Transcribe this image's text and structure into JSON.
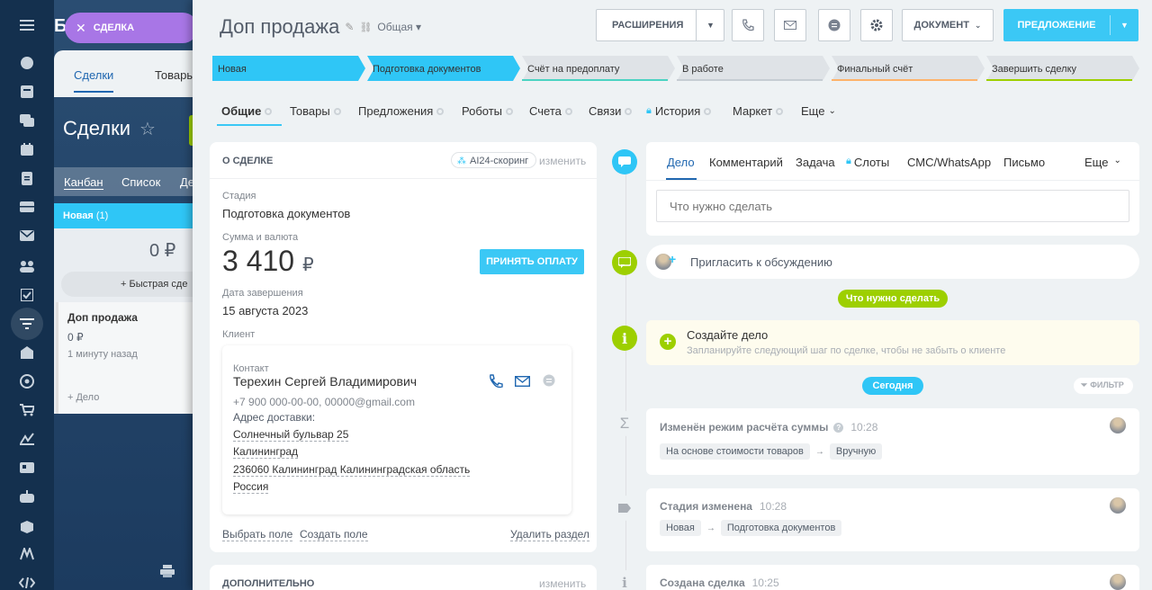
{
  "bg": {
    "logo": "Битрикс",
    "deal_pill": "СДЕЛКА",
    "tabs": [
      "Сделки",
      "Товары"
    ],
    "page_title": "Сделки",
    "views": [
      "Канбан",
      "Список",
      "Де"
    ],
    "column": {
      "name": "Новая",
      "count": "(1)",
      "sum": "0 ₽",
      "quick_add": "Быстрая сде"
    },
    "card": {
      "title": "Доп продажа",
      "sum": "0 ₽",
      "time": "1 минуту назад",
      "add": "+ Дело"
    }
  },
  "header": {
    "title": "Доп продажа",
    "category": "Общая",
    "extensions": "РАСШИРЕНИЯ",
    "document": "ДОКУМЕНТ",
    "offer": "ПРЕДЛОЖЕНИЕ"
  },
  "stages": [
    {
      "label": "Новая",
      "state": "done"
    },
    {
      "label": "Подготовка документов",
      "state": "current"
    },
    {
      "label": "Счёт на предоплату",
      "state": "todo"
    },
    {
      "label": "В работе",
      "state": "todo"
    },
    {
      "label": "Финальный счёт",
      "state": "todo"
    },
    {
      "label": "Завершить сделку",
      "state": "todo"
    }
  ],
  "tabs": [
    "Общие",
    "Товары",
    "Предложения",
    "Роботы",
    "Счета",
    "Связи",
    "История",
    "Маркет",
    "Еще"
  ],
  "about": {
    "title": "О СДЕЛКЕ",
    "ai_badge": "AI24-скоринг",
    "edit": "изменить",
    "stage_label": "Стадия",
    "stage_value": "Подготовка документов",
    "amount_label": "Сумма и валюта",
    "amount_value": "3 410",
    "currency": "₽",
    "accept_payment": "ПРИНЯТЬ ОПЛАТУ",
    "close_date_label": "Дата завершения",
    "close_date_value": "15 августа 2023",
    "client_label": "Клиент",
    "contact_label": "Контакт",
    "contact_name": "Терехин Сергей Владимирович",
    "contact_info": "+7 900 000-00-00, 00000@gmail.com",
    "address_label": "Адрес доставки:",
    "address_lines": [
      "Солнечный бульвар 25",
      "Калининград",
      "236060 Калининград Калининградская область",
      "Россия"
    ],
    "choose_field": "Выбрать поле",
    "create_field": "Создать поле",
    "delete_section": "Удалить раздел"
  },
  "additional": {
    "title": "ДОПОЛНИТЕЛЬНО",
    "edit": "изменить"
  },
  "activity": {
    "tabs": [
      "Дело",
      "Комментарий",
      "Задача",
      "Слоты",
      "СМС/WhatsApp",
      "Письмо",
      "Еще"
    ],
    "placeholder": "Что нужно сделать",
    "invite": "Пригласить к обсуждению"
  },
  "timeline": {
    "todo_tag": "Что нужно сделать",
    "create_title": "Создайте дело",
    "create_sub": "Запланируйте следующий шаг по сделке, чтобы не забыть о клиенте",
    "today_tag": "Сегодня",
    "filter": "ФИЛЬТР",
    "events": [
      {
        "title": "Изменён режим расчёта суммы",
        "time": "10:28",
        "from": "На основе стоимости товаров",
        "to": "Вручную"
      },
      {
        "title": "Стадия изменена",
        "time": "10:28",
        "from": "Новая",
        "to": "Подготовка документов"
      },
      {
        "title": "Создана сделка",
        "time": "10:25"
      }
    ]
  },
  "colors": {
    "accent": "#3bc8f5",
    "green": "#9dcf00",
    "nav_bg": "#14304e"
  }
}
